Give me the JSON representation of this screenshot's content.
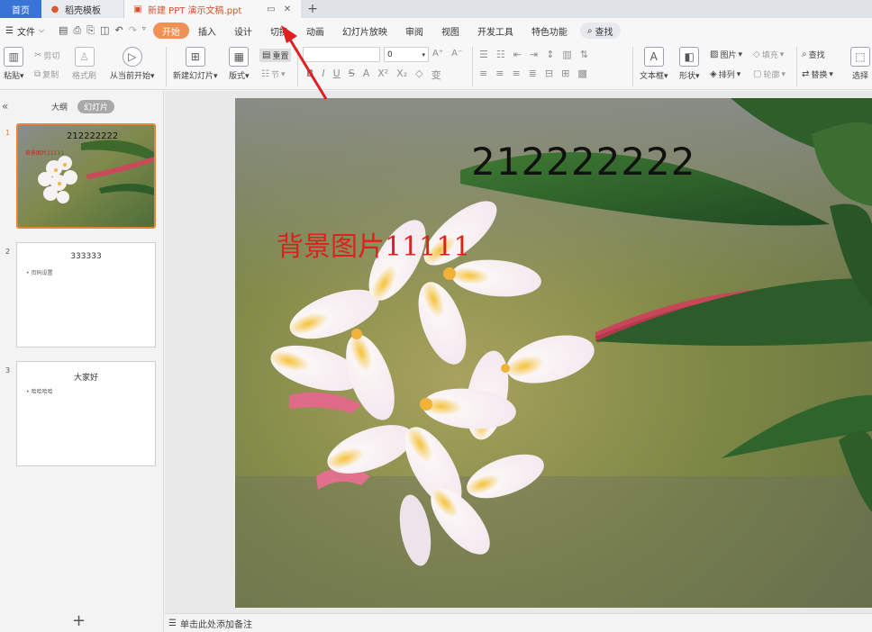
{
  "titlebar": {
    "home_tab": "首页",
    "templates_tab": "稻壳模板",
    "doc_tab": "新建 PPT 演示文稿.ppt",
    "new_tab": "+"
  },
  "menu": {
    "file": "文件",
    "tabs": [
      "开始",
      "插入",
      "设计",
      "切换",
      "动画",
      "幻灯片放映",
      "审阅",
      "视图",
      "开发工具",
      "特色功能"
    ],
    "active_tab": "开始",
    "search": "查找"
  },
  "ribbon": {
    "paste": "粘贴",
    "cut": "剪切",
    "copy": "复制",
    "format_painter": "格式刷",
    "from_current": "从当前开始",
    "new_slide": "新建幻灯片",
    "layout": "版式",
    "reset": "重置",
    "section": "节",
    "font_size": "0",
    "text_box": "文本框",
    "shape": "形状",
    "picture": "图片",
    "fill": "填充",
    "arrange": "排列",
    "outline": "轮廓",
    "find": "查找",
    "replace": "替换",
    "select": "选择"
  },
  "left_panel": {
    "outline_tab": "大纲",
    "slides_tab": "幻灯片",
    "slides": [
      {
        "num": "1",
        "title": "212222222",
        "bullet": ""
      },
      {
        "num": "2",
        "title": "333333",
        "bullet": "• 页码设置"
      },
      {
        "num": "3",
        "title": "大家好",
        "bullet": "• 哈哈哈哈"
      }
    ],
    "add_icon": "+"
  },
  "slide": {
    "title": "212222222",
    "subtitle": "背景图片11111"
  },
  "notes": {
    "placeholder": "单击此处添加备注"
  },
  "colors": {
    "accent_orange": "#f09053",
    "home_blue": "#3a73d6",
    "selected_border": "#e8833a",
    "subtitle_red": "#d8241c",
    "arrow_red": "#e02020"
  }
}
